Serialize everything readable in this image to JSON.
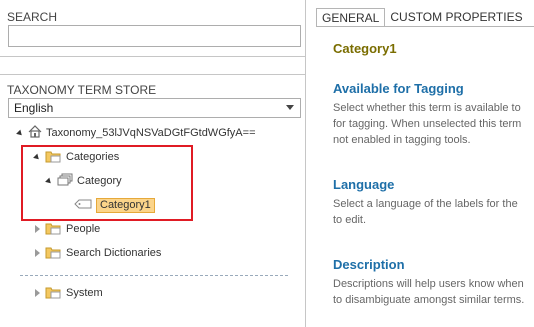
{
  "left": {
    "search": {
      "title": "SEARCH",
      "value": ""
    },
    "store": {
      "title": "TAXONOMY TERM STORE",
      "language": "English"
    },
    "tree": {
      "root": "Taxonomy_53lJVqNSVaDGtFGtdWGfyA==",
      "categories": "Categories",
      "category": "Category",
      "category1": "Category1",
      "people": "People",
      "search_dictionaries": "Search Dictionaries",
      "system": "System"
    }
  },
  "right": {
    "tabs": [
      "GENERAL",
      "CUSTOM PROPERTIES"
    ],
    "term_title": "Category1",
    "available": {
      "heading": "Available for Tagging",
      "lines": [
        "Select whether this term is available to",
        "for tagging. When unselected this term",
        "not enabled in tagging tools."
      ]
    },
    "language": {
      "heading": "Language",
      "lines": [
        "Select a language of the labels for the",
        "to edit."
      ]
    },
    "description": {
      "heading": "Description",
      "lines": [
        "Descriptions will help users know when",
        "to disambiguate amongst similar terms."
      ]
    }
  }
}
